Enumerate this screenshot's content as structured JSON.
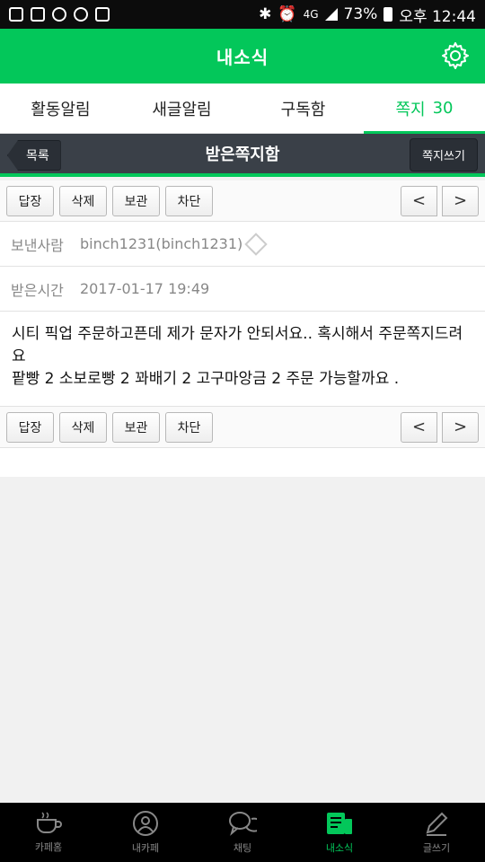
{
  "status": {
    "time": "오후 12:44",
    "battery": "73%",
    "network": "4G",
    "left_icons": [
      "gallery-icon",
      "image-icon",
      "talk-icon",
      "sync-icon",
      "bag-icon"
    ],
    "right_icons": [
      "bluetooth-icon",
      "alarm-icon",
      "signal-icon",
      "battery-icon"
    ]
  },
  "header": {
    "title": "내소식"
  },
  "tabs": [
    {
      "label": "활동알림",
      "count": ""
    },
    {
      "label": "새글알림",
      "count": ""
    },
    {
      "label": "구독함",
      "count": ""
    },
    {
      "label": "쪽지",
      "count": "30"
    }
  ],
  "subbar": {
    "back_label": "목록",
    "title": "받은쪽지함",
    "write_label": "쪽지쓰기"
  },
  "actions": {
    "reply": "답장",
    "delete": "삭제",
    "archive": "보관",
    "block": "차단",
    "prev": "<",
    "next": ">"
  },
  "message": {
    "sender_label": "보낸사람",
    "sender_value": "binch1231(binch1231)",
    "time_label": "받은시간",
    "time_value": "2017-01-17 19:49",
    "body": "시티 픽업 주문하고픈데 제가 문자가 안되서요.. 혹시해서 주문쪽지드려요\n팥빵 2 소보로빵 2 꽈배기 2 고구마앙금 2 주문 가능할까요 ."
  },
  "bottom_nav": [
    {
      "label": "카페홈",
      "icon": "cup-icon"
    },
    {
      "label": "내카페",
      "icon": "person-icon"
    },
    {
      "label": "채팅",
      "icon": "chat-icon"
    },
    {
      "label": "내소식",
      "icon": "news-icon"
    },
    {
      "label": "글쓰기",
      "icon": "pencil-icon"
    }
  ],
  "colors": {
    "accent": "#03c75a",
    "subbar": "#3a4048"
  }
}
